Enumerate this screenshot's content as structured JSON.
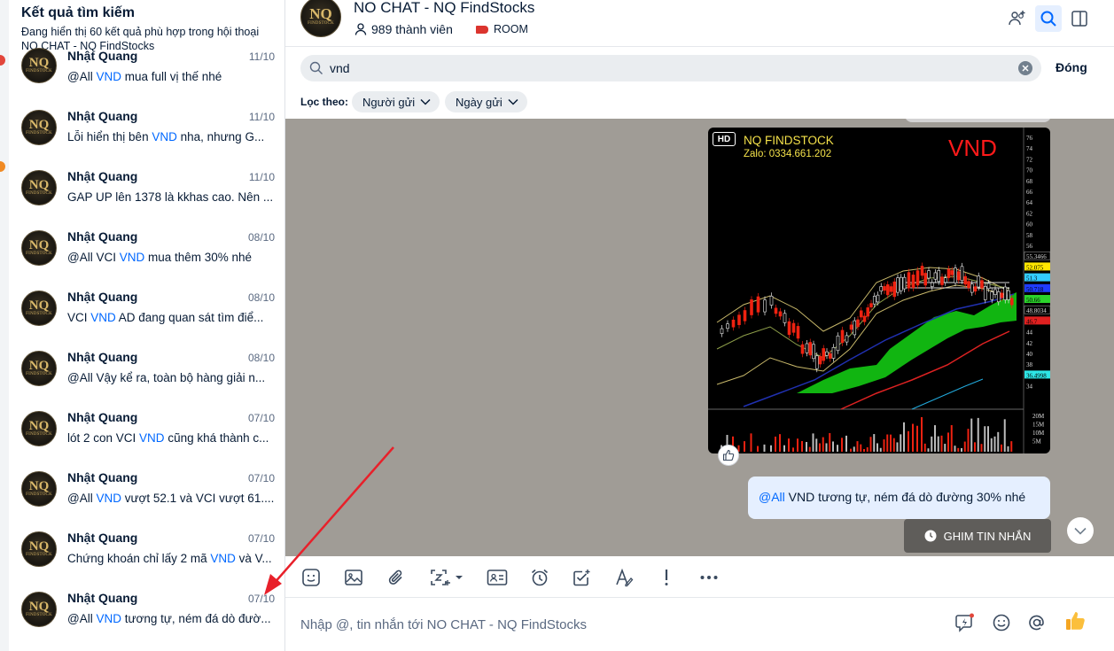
{
  "results_panel": {
    "title": "Kết quả tìm kiếm",
    "subtitle": "Đang hiển thị 60 kết quả phù hợp trong hội thoại",
    "conversation_name": "NO CHAT - NQ FindStocks",
    "items": [
      {
        "sender": "Nhật Quang",
        "date": "11/10",
        "pre": "@All ",
        "hl": "VND",
        "post": " mua full vị thế nhé"
      },
      {
        "sender": "Nhật Quang",
        "date": "11/10",
        "pre": "Lỗi hiển thị bên ",
        "hl": "VND",
        "post": " nha, nhưng G..."
      },
      {
        "sender": "Nhật Quang",
        "date": "11/10",
        "pre": "GAP UP lên 1378 là kkhas cao. Nên ...",
        "hl": "",
        "post": ""
      },
      {
        "sender": "Nhật Quang",
        "date": "08/10",
        "pre": "@All VCI ",
        "hl": "VND",
        "post": " mua thêm 30% nhé"
      },
      {
        "sender": "Nhật Quang",
        "date": "08/10",
        "pre": "VCI ",
        "hl": "VND",
        "post": " AD đang quan sát tìm điể..."
      },
      {
        "sender": "Nhật Quang",
        "date": "08/10",
        "pre": "@All Vậy kể ra, toàn bộ hàng giải n...",
        "hl": "",
        "post": ""
      },
      {
        "sender": "Nhật Quang",
        "date": "07/10",
        "pre": "lót 2 con VCI ",
        "hl": "VND",
        "post": " cũng khá thành c..."
      },
      {
        "sender": "Nhật Quang",
        "date": "07/10",
        "pre": "@All ",
        "hl": "VND",
        "post": " vượt 52.1 và VCI vượt 61...."
      },
      {
        "sender": "Nhật Quang",
        "date": "07/10",
        "pre": "Chứng khoán chỉ lấy 2 mã ",
        "hl": "VND",
        "post": " và V..."
      },
      {
        "sender": "Nhật Quang",
        "date": "07/10",
        "pre": "@All ",
        "hl": "VND",
        "post": " tương tự, ném đá dò đườ..."
      }
    ]
  },
  "conversation": {
    "title": "NO CHAT - NQ FindStocks",
    "members": "989 thành viên",
    "tag": "ROOM",
    "avatar_text": "NQ",
    "avatar_subtext": "FINDSTOCK"
  },
  "search": {
    "query": "vnd",
    "close_label": "Đóng",
    "filter_label": "Lọc theo:",
    "filter_sender": "Người gửi",
    "filter_date": "Ngày gửi"
  },
  "messages": {
    "image": {
      "hd_badge": "HD",
      "brand": "NQ FINDSTOCK",
      "contact": "Zalo: 0334.661.202",
      "ticker": "VND",
      "price_labels": [
        "76",
        "74",
        "72",
        "70",
        "68",
        "66",
        "64",
        "62",
        "60",
        "58",
        "56",
        "55.3466",
        "52.075",
        "51.3",
        "50.718",
        "50.66",
        "48.8034",
        "46.7",
        "44",
        "42",
        "40",
        "38",
        "36.4998",
        "34"
      ],
      "volume_labels": [
        "20M",
        "15M",
        "10M",
        "5M"
      ]
    },
    "text_mention": "@All",
    "text_body": " VND tương tự, ném đá dò đường 30% nhé",
    "pin_label": "GHIM TIN NHẮN"
  },
  "composer": {
    "placeholder": "Nhập @, tin nhắn tới NO CHAT - NQ FindStocks"
  },
  "colors": {
    "accent": "#0068ff",
    "message_bg": "#a09c96",
    "tag_red": "#db342e",
    "annotation_arrow": "#e8202a"
  }
}
